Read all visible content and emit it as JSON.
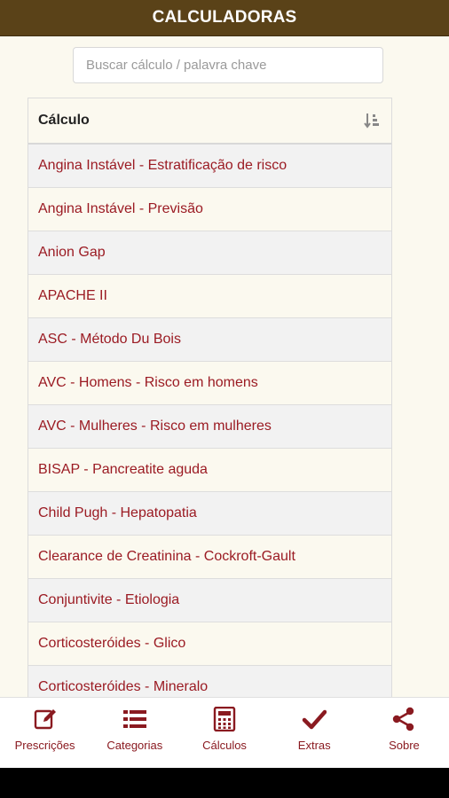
{
  "header": {
    "title": "CALCULADORAS"
  },
  "search": {
    "placeholder": "Buscar cálculo / palavra chave"
  },
  "table": {
    "column_header": "Cálculo",
    "rows": [
      "Angina Instável - Estratificação de risco",
      "Angina Instável - Previsão",
      "Anion Gap",
      "APACHE II",
      "ASC - Método Du Bois",
      "AVC - Homens - Risco em homens",
      "AVC - Mulheres - Risco em mulheres",
      "BISAP - Pancreatite aguda",
      "Child Pugh - Hepatopatia",
      "Clearance de Creatinina - Cockroft-Gault",
      "Conjuntivite - Etiologia",
      "Corticosteróides - Glico",
      "Corticosteróides - Mineralo"
    ]
  },
  "bottom_nav": {
    "items": [
      {
        "label": "Prescrições",
        "icon": "edit-icon"
      },
      {
        "label": "Categorias",
        "icon": "list-icon"
      },
      {
        "label": "Cálculos",
        "icon": "calculator-icon"
      },
      {
        "label": "Extras",
        "icon": "check-icon"
      },
      {
        "label": "Sobre",
        "icon": "share-icon"
      }
    ]
  },
  "colors": {
    "header_bg": "#5a4218",
    "accent_red": "#9b1b23",
    "page_bg": "#fbf9ef"
  }
}
